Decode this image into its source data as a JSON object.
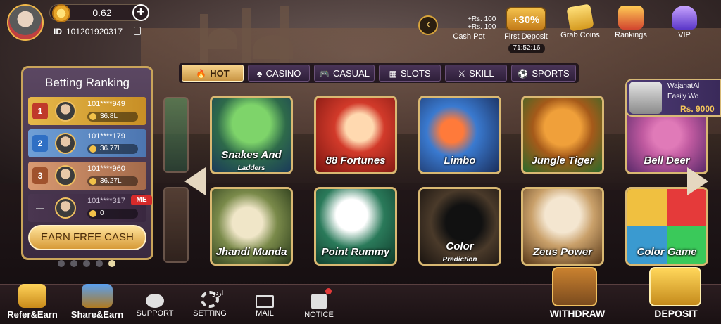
{
  "header": {
    "balance": "0.62",
    "id_label": "ID",
    "user_id": "101201920317"
  },
  "top_menu": {
    "cash_pot_line1": "+Rs. 100",
    "cash_pot_line2": "+Rs. 100",
    "cash_pot": "Cash Pot",
    "first_deposit_badge": "+30%",
    "first_deposit": "First Deposit",
    "timer": "71:52:16",
    "grab_coins": "Grab Coins",
    "rankings": "Rankings",
    "vip": "VIP"
  },
  "tabs": [
    {
      "label": "HOT",
      "glyph": "🔥"
    },
    {
      "label": "CASINO",
      "glyph": "♣"
    },
    {
      "label": "CASUAL",
      "glyph": "🎮"
    },
    {
      "label": "SLOTS",
      "glyph": "▦"
    },
    {
      "label": "SKILL",
      "glyph": "⚔"
    },
    {
      "label": "SPORTS",
      "glyph": "⚽"
    }
  ],
  "ranking": {
    "title": "Betting Ranking",
    "rows": [
      {
        "rank": "1",
        "user": "101****949",
        "amount": "36.8L"
      },
      {
        "rank": "2",
        "user": "101****179",
        "amount": "36.77L"
      },
      {
        "rank": "3",
        "user": "101****960",
        "amount": "36.27L"
      },
      {
        "rank": "—",
        "user": "101****317",
        "amount": "0"
      }
    ],
    "me_badge": "ME",
    "earn_button": "EARN FREE CASH"
  },
  "games": [
    {
      "name": "Snakes And",
      "sub": "Ladders",
      "color1": "#4aa84a",
      "color2": "#1f5a8a"
    },
    {
      "name": "88 Fortunes",
      "sub": "",
      "color1": "#d23a2a",
      "color2": "#7a1510"
    },
    {
      "name": "Limbo",
      "sub": "",
      "color1": "#3a7ad0",
      "color2": "#1a2d5a"
    },
    {
      "name": "Jungle Tiger",
      "sub": "",
      "color1": "#e08a2a",
      "color2": "#2a6a2a"
    },
    {
      "name": "Bell Deer",
      "sub": "",
      "color1": "#c05aa0",
      "color2": "#5a2a6a"
    },
    {
      "name": "Jhandi Munda",
      "sub": "",
      "color1": "#7a8a4a",
      "color2": "#2a3a1a"
    },
    {
      "name": "Point Rummy",
      "sub": "",
      "color1": "#2a7a5a",
      "color2": "#0f3a2a"
    },
    {
      "name": "Color",
      "sub": "Prediction",
      "color1": "#4a3a2a",
      "color2": "#1a1410"
    },
    {
      "name": "Zeus Power",
      "sub": "",
      "color1": "#c9a06a",
      "color2": "#5a3a1a"
    },
    {
      "name": "Color Game",
      "sub": "",
      "color1": "#3a9ad0",
      "color2": "#6a2aa0"
    }
  ],
  "promo": {
    "name": "WajahatAl",
    "text": "Easily Wo",
    "amount": "Rs. 9000"
  },
  "bottom_nav": {
    "refer": "Refer&Earn",
    "share": "Share&Earn",
    "support": "SUPPORT",
    "setting": "SETTING",
    "setting_icon_text": "اردو",
    "mail": "MAIL",
    "notice": "NOTICE",
    "withdraw": "WITHDRAW",
    "deposit": "DEPOSIT"
  },
  "colors": {
    "gold": "#d9b872",
    "active_tab": "#f6d28a",
    "panel": "#4a3650",
    "alert_red": "#e23a3a"
  }
}
